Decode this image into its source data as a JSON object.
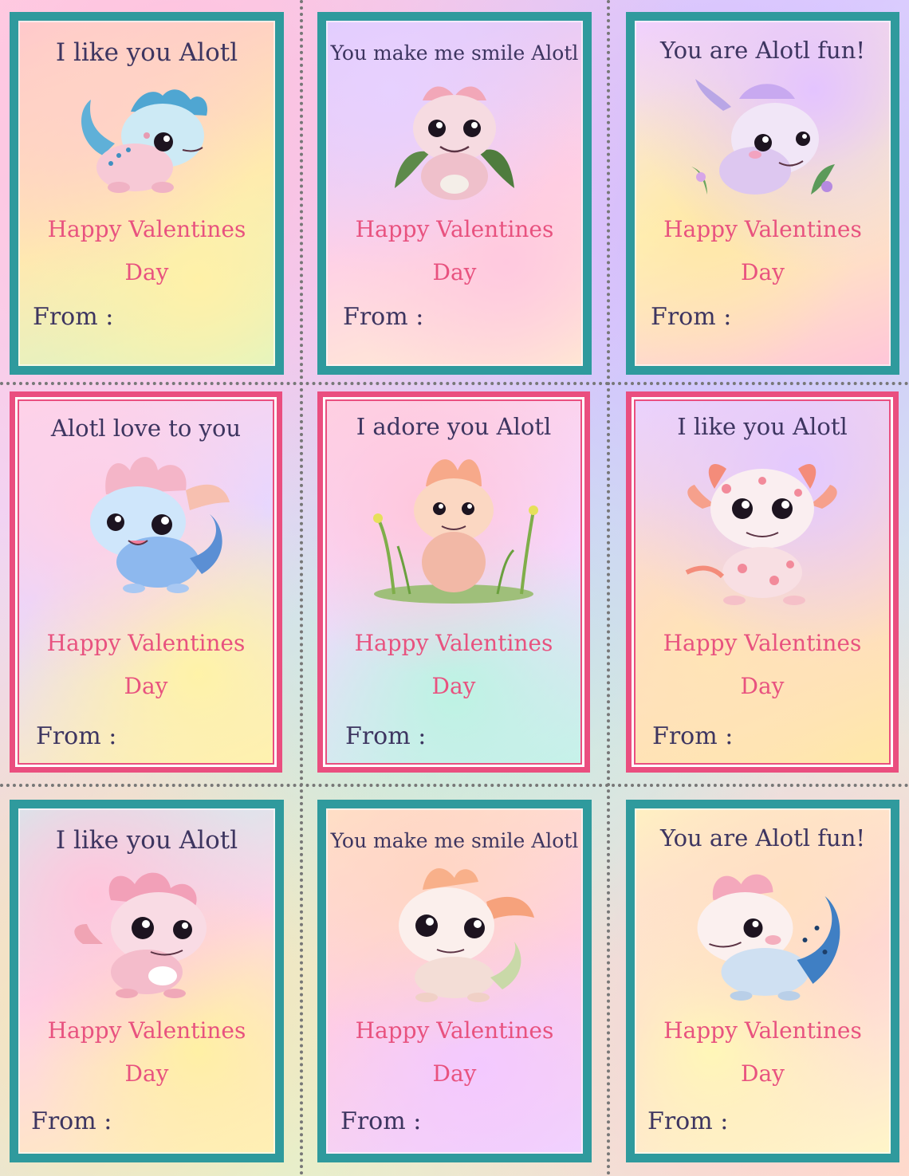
{
  "cards": [
    {
      "tagline": "I like you Alotl",
      "greeting_line1": "Happy Valentines",
      "greeting_line2": "Day",
      "from_label": "From :",
      "border": "teal",
      "creature_icon": "blue-axolotl-icon"
    },
    {
      "tagline": "You make me smile Alotl",
      "greeting_line1": "Happy Valentines",
      "greeting_line2": "Day",
      "from_label": "From :",
      "border": "teal",
      "creature_icon": "pink-axolotl-leaves-icon"
    },
    {
      "tagline": "You are Alotl fun!",
      "greeting_line1": "Happy Valentines",
      "greeting_line2": "Day",
      "from_label": "From :",
      "border": "teal",
      "creature_icon": "lavender-axolotl-flowers-icon"
    },
    {
      "tagline": "Alotl love to you",
      "greeting_line1": "Happy Valentines",
      "greeting_line2": "Day",
      "from_label": "From :",
      "border": "pink",
      "creature_icon": "blue-spiky-axolotl-icon"
    },
    {
      "tagline": "I adore you Alotl",
      "greeting_line1": "Happy Valentines",
      "greeting_line2": "Day",
      "from_label": "From :",
      "border": "pink",
      "creature_icon": "peach-axolotl-grass-icon"
    },
    {
      "tagline": "I like you Alotl",
      "greeting_line1": "Happy Valentines",
      "greeting_line2": "Day",
      "from_label": "From :",
      "border": "pink",
      "creature_icon": "spotted-axolotl-icon"
    },
    {
      "tagline": "I like you Alotl",
      "greeting_line1": "Happy Valentines",
      "greeting_line2": "Day",
      "from_label": "From :",
      "border": "teal",
      "creature_icon": "pink-axolotl-icon"
    },
    {
      "tagline": "You make me smile Alotl",
      "greeting_line1": "Happy Valentines",
      "greeting_line2": "Day",
      "from_label": "From :",
      "border": "teal",
      "creature_icon": "white-axolotl-orange-gills-icon"
    },
    {
      "tagline": "You are Alotl fun!",
      "greeting_line1": "Happy Valentines",
      "greeting_line2": "Day",
      "from_label": "From :",
      "border": "teal",
      "creature_icon": "white-axolotl-blue-tail-icon"
    }
  ],
  "colors": {
    "teal_border": "#2f9a9d",
    "pink_border": "#ea4e7f",
    "tagline_text": "#3d3560",
    "greeting_text": "#e8527f"
  }
}
